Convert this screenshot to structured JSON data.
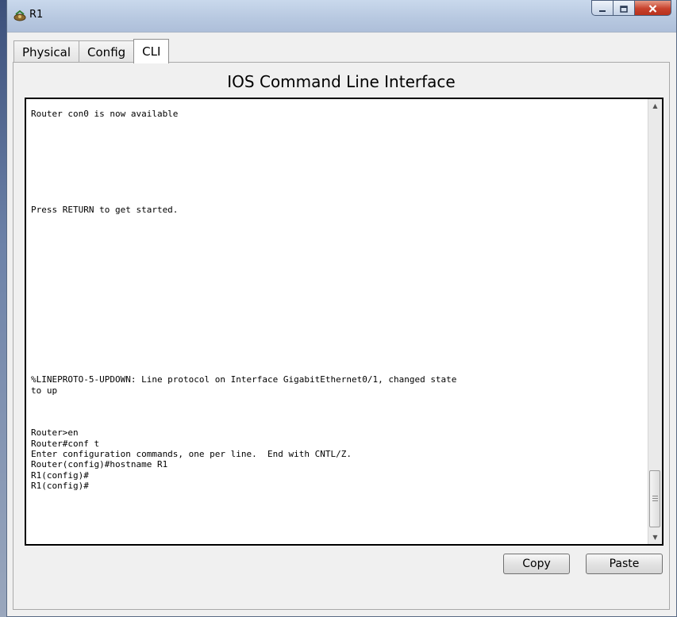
{
  "window": {
    "title": "R1",
    "controls": [
      "minimize-icon",
      "maximize-icon",
      "close-icon"
    ]
  },
  "tabs": [
    {
      "label": "Physical",
      "active": false
    },
    {
      "label": "Config",
      "active": false
    },
    {
      "label": "CLI",
      "active": true
    }
  ],
  "cli": {
    "heading": "IOS Command Line Interface",
    "output": "Router con0 is now available\n\n\n\n\n\n\n\n\nPress RETURN to get started.\n\n\n\n\n\n\n\n\n\n\n\n\n\n\n\n%LINEPROTO-5-UPDOWN: Line protocol on Interface GigabitEthernet0/1, changed state\nto up\n\n\n\nRouter>en\nRouter#conf t\nEnter configuration commands, one per line.  End with CNTL/Z.\nRouter(config)#hostname R1\nR1(config)#\nR1(config)#"
  },
  "buttons": {
    "copy": "Copy",
    "paste": "Paste"
  },
  "colors": {
    "close_button": "#c7412c",
    "terminal_background": "#ffffff",
    "terminal_border": "#000000"
  }
}
